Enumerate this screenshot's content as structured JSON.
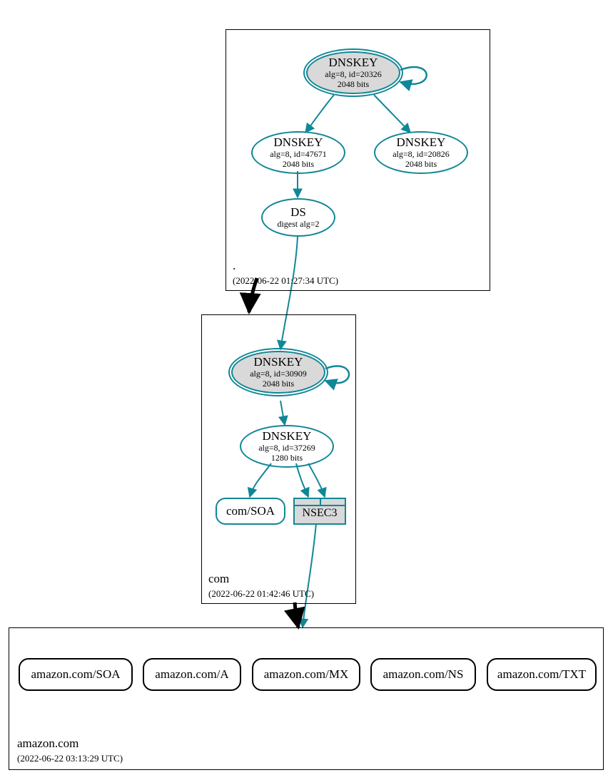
{
  "zones": {
    "root": {
      "name": ".",
      "timestamp": "(2022-06-22 01:27:34 UTC)",
      "nodes": {
        "ksk": {
          "title": "DNSKEY",
          "alg": "alg=8, id=20326",
          "bits": "2048 bits"
        },
        "zsk1": {
          "title": "DNSKEY",
          "alg": "alg=8, id=47671",
          "bits": "2048 bits"
        },
        "zsk2": {
          "title": "DNSKEY",
          "alg": "alg=8, id=20826",
          "bits": "2048 bits"
        },
        "ds": {
          "title": "DS",
          "sub": "digest alg=2"
        }
      }
    },
    "com": {
      "name": "com",
      "timestamp": "(2022-06-22 01:42:46 UTC)",
      "nodes": {
        "ksk": {
          "title": "DNSKEY",
          "alg": "alg=8, id=30909",
          "bits": "2048 bits"
        },
        "zsk": {
          "title": "DNSKEY",
          "alg": "alg=8, id=37269",
          "bits": "1280 bits"
        },
        "soa": "com/SOA",
        "nsec3": "NSEC3"
      }
    },
    "amazon": {
      "name": "amazon.com",
      "timestamp": "(2022-06-22 03:13:29 UTC)",
      "records": [
        "amazon.com/SOA",
        "amazon.com/A",
        "amazon.com/MX",
        "amazon.com/NS",
        "amazon.com/TXT"
      ]
    }
  }
}
